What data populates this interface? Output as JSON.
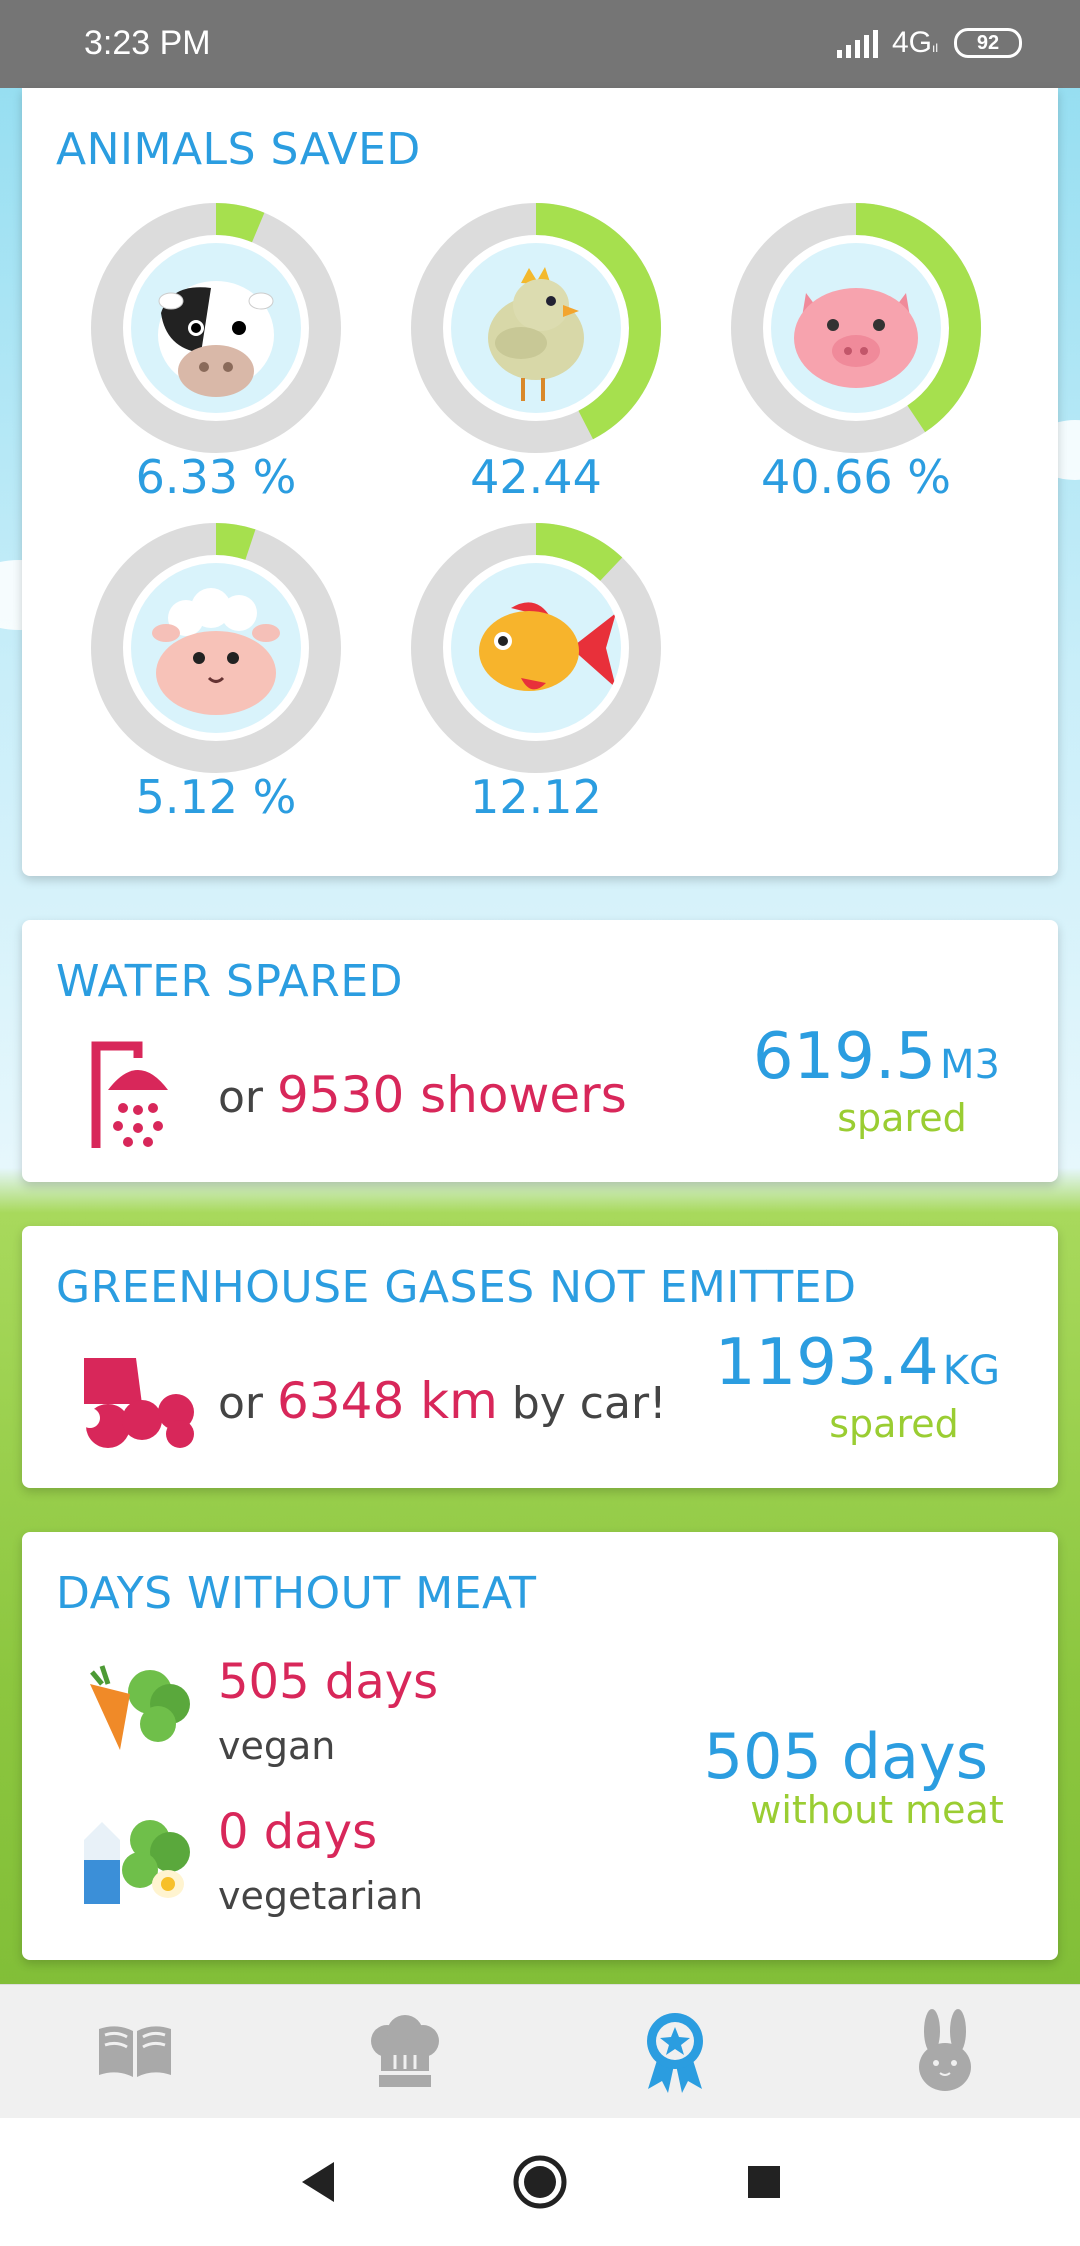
{
  "status_bar": {
    "time": "3:23 PM",
    "network": "4G",
    "battery": "92"
  },
  "animals": {
    "title": "ANIMALS SAVED",
    "items": [
      {
        "icon": "cow-icon",
        "label": "6.33 %",
        "fraction": 0.0633
      },
      {
        "icon": "chicken-icon",
        "label": "42.44",
        "fraction": 0.4244
      },
      {
        "icon": "pig-icon",
        "label": "40.66 %",
        "fraction": 0.4066
      },
      {
        "icon": "sheep-icon",
        "label": "5.12 %",
        "fraction": 0.0512
      },
      {
        "icon": "fish-icon",
        "label": "12.12",
        "fraction": 0.1212
      }
    ],
    "ring_color": "#a6e04e",
    "track_color": "#dcdcdc"
  },
  "water": {
    "title": "WATER SPARED",
    "or": "or",
    "highlight": "9530 showers",
    "value": "619.5",
    "unit": "M3",
    "spared": "spared",
    "icon": "shower-icon"
  },
  "gas": {
    "title": "GREENHOUSE GASES NOT EMITTED",
    "or": "or",
    "highlight": "6348 km",
    "suffix": "by car!",
    "value": "1193.4",
    "unit": "KG",
    "spared": "spared",
    "icon": "exhaust-icon"
  },
  "days": {
    "title": "DAYS WITHOUT MEAT",
    "vegan_count": "505 days",
    "vegan_label": "vegan",
    "vegetarian_count": "0 days",
    "vegetarian_label": "vegetarian",
    "total": "505 days",
    "total_label": "without meat"
  },
  "nav": {
    "items": [
      "book-icon",
      "chef-hat-icon",
      "award-icon",
      "rabbit-icon"
    ],
    "active": "award-icon"
  },
  "colors": {
    "accent_blue": "#2b9de0",
    "highlight_pink": "#d8275a",
    "lime": "#9acd32"
  }
}
